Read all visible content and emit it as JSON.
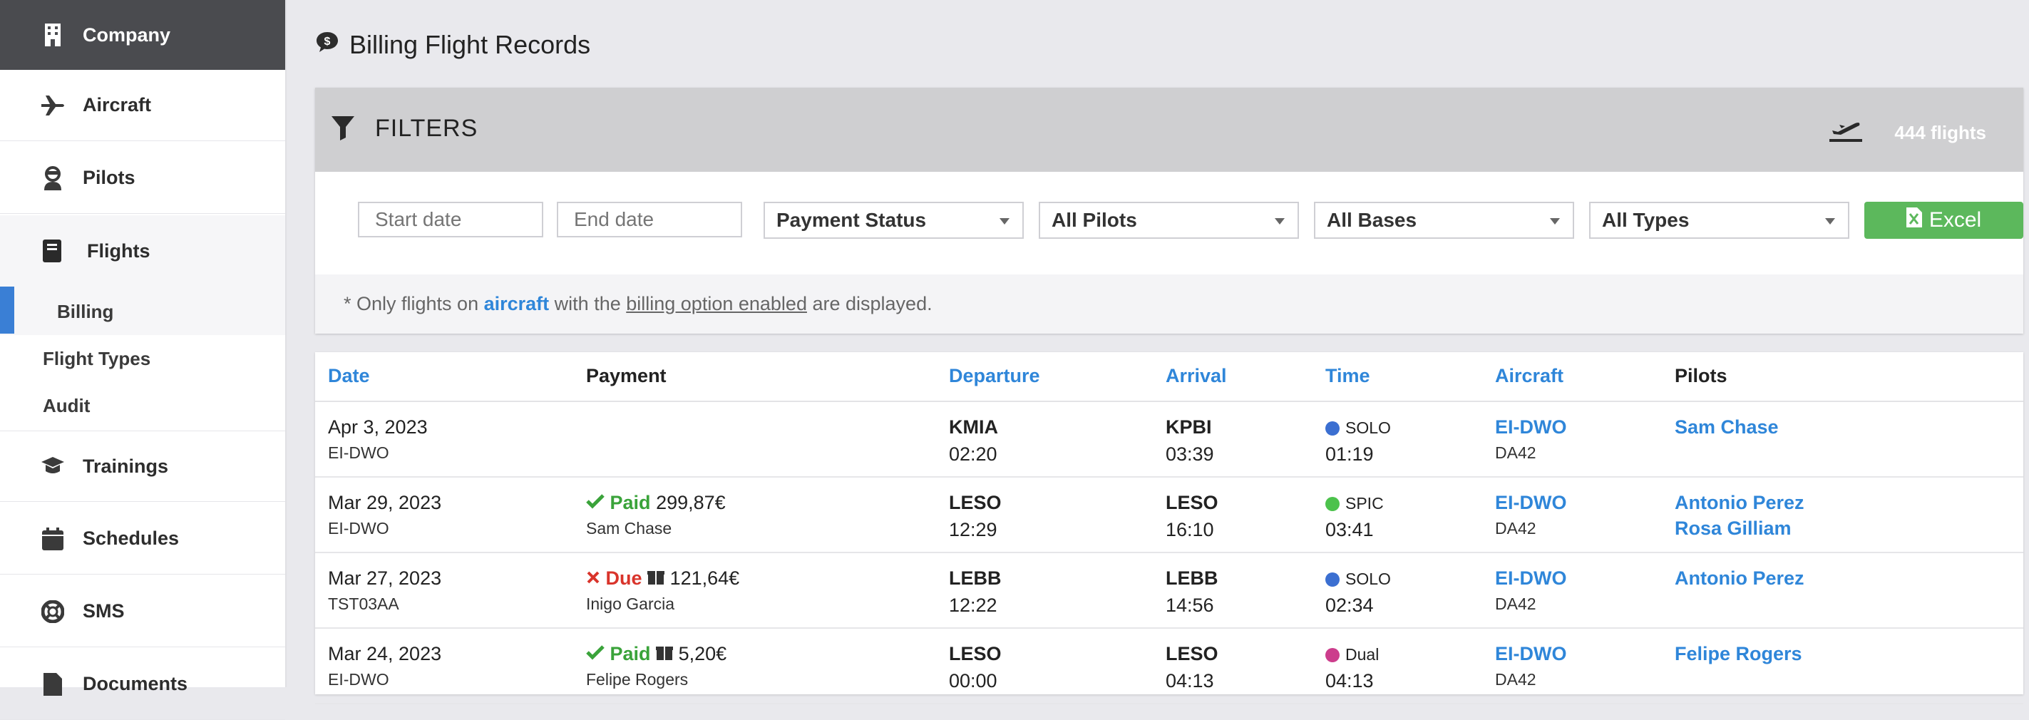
{
  "sidebar": {
    "company": "Company",
    "aircraft": "Aircraft",
    "pilots": "Pilots",
    "flights": "Flights",
    "billing": "Billing",
    "flight_types": "Flight Types",
    "audit": "Audit",
    "trainings": "Trainings",
    "schedules": "Schedules",
    "sms": "SMS",
    "documents": "Documents"
  },
  "page_title": "Billing Flight Records",
  "filters": {
    "title": "FILTERS",
    "flights_count": "444 flights",
    "start_date_placeholder": "Start date",
    "end_date_placeholder": "End date",
    "payment_status": "Payment Status",
    "all_pilots": "All Pilots",
    "all_bases": "All Bases",
    "all_types": "All Types",
    "excel_label": "Excel",
    "note_prefix": "* Only flights on",
    "note_aircraft": "aircraft",
    "note_mid": "with the",
    "note_billing": "billing option enabled",
    "note_suffix": "are displayed."
  },
  "table": {
    "headers": {
      "date": "Date",
      "payment": "Payment",
      "departure": "Departure",
      "arrival": "Arrival",
      "time": "Time",
      "aircraft": "Aircraft",
      "pilots": "Pilots"
    },
    "rows": [
      {
        "date": "Apr 3, 2023",
        "reg": "EI-DWO",
        "payment_status": "",
        "payment_amount": "",
        "payment_by": "",
        "dep": "KMIA",
        "dep_time": "02:20",
        "arr": "KPBI",
        "arr_time": "03:39",
        "type": "SOLO",
        "duration": "01:19",
        "aircraft": "EI-DWO",
        "model": "DA42",
        "pilot1": "Sam Chase",
        "pilot2": ""
      },
      {
        "date": "Mar 29, 2023",
        "reg": "EI-DWO",
        "payment_status": "Paid",
        "payment_amount": "299,87€",
        "payment_by": "Sam Chase",
        "dep": "LESO",
        "dep_time": "12:29",
        "arr": "LESO",
        "arr_time": "16:10",
        "type": "SPIC",
        "duration": "03:41",
        "aircraft": "EI-DWO",
        "model": "DA42",
        "pilot1": "Antonio Perez",
        "pilot2": "Rosa Gilliam"
      },
      {
        "date": "Mar 27, 2023",
        "reg": "TST03AA",
        "payment_status": "Due",
        "payment_amount": "121,64€",
        "payment_by": "Inigo Garcia",
        "dep": "LEBB",
        "dep_time": "12:22",
        "arr": "LEBB",
        "arr_time": "14:56",
        "type": "SOLO",
        "duration": "02:34",
        "aircraft": "EI-DWO",
        "model": "DA42",
        "pilot1": "Antonio Perez",
        "pilot2": ""
      },
      {
        "date": "Mar 24, 2023",
        "reg": "EI-DWO",
        "payment_status": "Paid",
        "payment_amount": "5,20€",
        "payment_by": "Felipe Rogers",
        "dep": "LESO",
        "dep_time": "00:00",
        "arr": "LESO",
        "arr_time": "04:13",
        "type": "Dual",
        "duration": "04:13",
        "aircraft": "EI-DWO",
        "model": "DA42",
        "pilot1": "Felipe Rogers",
        "pilot2": ""
      }
    ]
  },
  "colors": {
    "solo": "#3b6fd1",
    "spic": "#4cc24c",
    "dual": "#cc3d8c",
    "accent": "#2f86d9",
    "excel": "#5cb85c"
  }
}
